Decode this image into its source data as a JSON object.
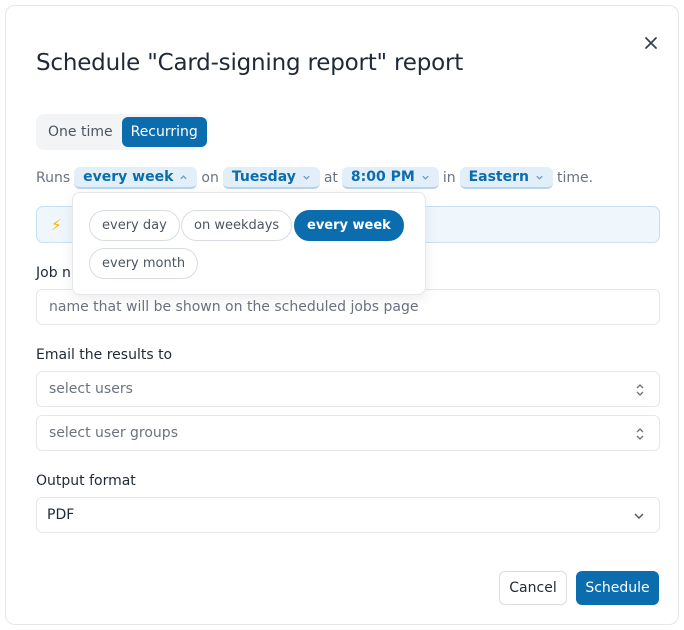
{
  "modal": {
    "title": "Schedule \"Card-signing report\" report",
    "close_icon": "close-icon"
  },
  "frequency_toggle": {
    "options": [
      "One time",
      "Recurring"
    ],
    "selected": "Recurring"
  },
  "runs": {
    "prefix": "Runs",
    "frequency": "every week",
    "on_word": "on",
    "day": "Tuesday",
    "at_word": "at",
    "time": "8:00 PM",
    "in_word": "in",
    "timezone": "Eastern",
    "suffix": "time."
  },
  "banner": {
    "icon": "lightning-icon"
  },
  "frequency_popover": {
    "options": [
      "every day",
      "on weekdays",
      "every week",
      "every month"
    ],
    "selected": "every week"
  },
  "job_name": {
    "label": "Job n",
    "placeholder": "name that will be shown on the scheduled jobs page"
  },
  "email": {
    "label": "Email the results to",
    "users_placeholder": "select users",
    "groups_placeholder": "select user groups"
  },
  "output": {
    "label": "Output format",
    "value": "PDF"
  },
  "footer": {
    "cancel_label": "Cancel",
    "schedule_label": "Schedule"
  },
  "colors": {
    "accent": "#0b6cae",
    "pill_bg": "#e2eef8",
    "banner_bg": "#eff7fd",
    "bolt": "#f5b400"
  }
}
